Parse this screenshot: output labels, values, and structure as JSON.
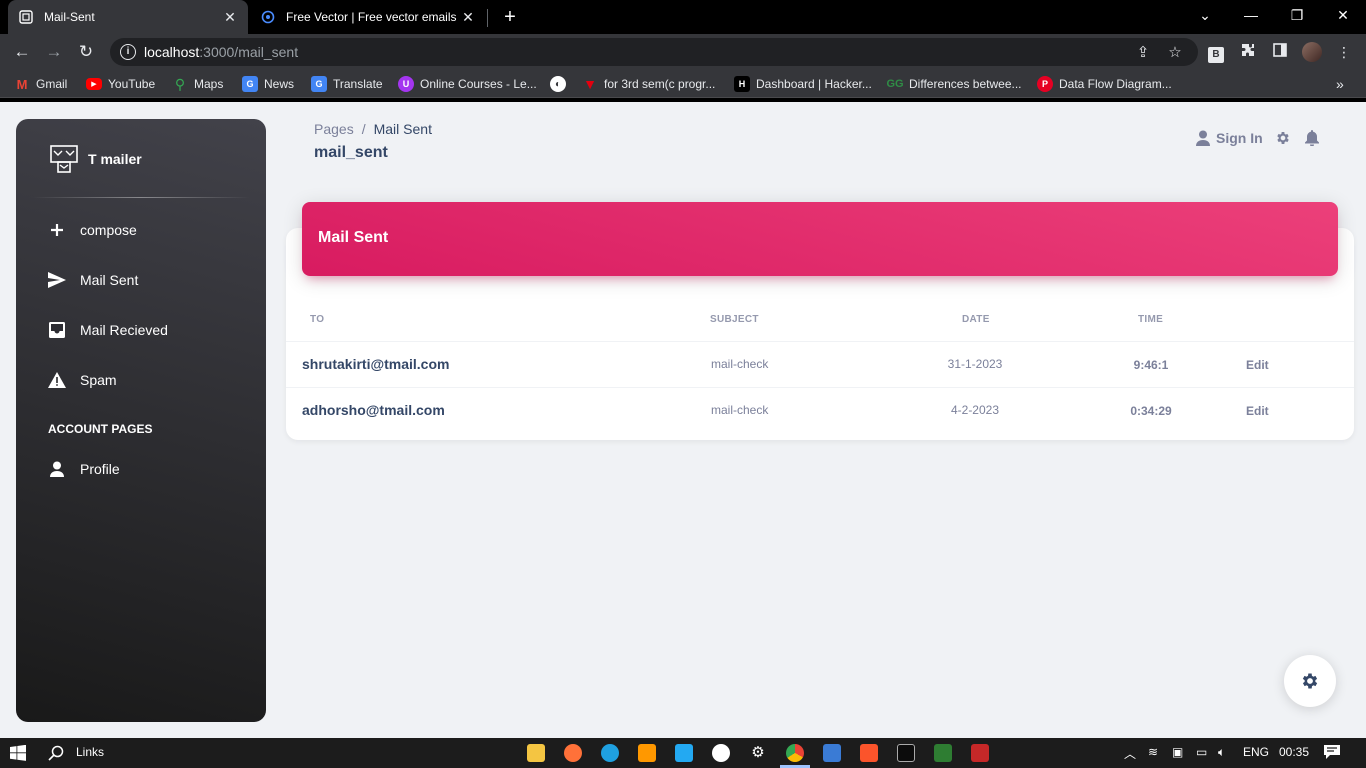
{
  "browser": {
    "tabs": [
      {
        "title": "Mail-Sent",
        "active": true
      },
      {
        "title": "Free Vector | Free vector emails c",
        "active": false
      }
    ],
    "url_host": "localhost",
    "url_path": ":3000/mail_sent",
    "bookmarks": [
      {
        "label": "Gmail",
        "icon": "gmail-icon",
        "color": "#ea4335"
      },
      {
        "label": "YouTube",
        "icon": "youtube-icon",
        "color": "#ff0000"
      },
      {
        "label": "Maps",
        "icon": "maps-icon",
        "color": "#34a853"
      },
      {
        "label": "News",
        "icon": "news-icon",
        "color": "#4285f4"
      },
      {
        "label": "Translate",
        "icon": "translate-icon",
        "color": "#4285f4"
      },
      {
        "label": "Online Courses - Le...",
        "icon": "udemy-icon",
        "color": "#a435f0"
      },
      {
        "label": "",
        "icon": "globe-icon",
        "color": "#ffffff"
      },
      {
        "label": "for 3rd sem(c progr...",
        "icon": "topcoder-icon",
        "color": "#e3000f"
      },
      {
        "label": "Dashboard | Hacker...",
        "icon": "hackerrank-icon",
        "color": "#000000"
      },
      {
        "label": "Differences betwee...",
        "icon": "geeksforgeeks-icon",
        "color": "#2f8d46"
      },
      {
        "label": "Data Flow Diagram...",
        "icon": "pinterest-icon",
        "color": "#e60023"
      }
    ]
  },
  "sidebar": {
    "brand": "T mailer",
    "items": [
      {
        "label": "compose",
        "icon": "plus-icon"
      },
      {
        "label": "Mail Sent",
        "icon": "send-icon"
      },
      {
        "label": "Mail Recieved",
        "icon": "inbox-icon"
      },
      {
        "label": "Spam",
        "icon": "warning-icon"
      }
    ],
    "section_title": "ACCOUNT PAGES",
    "account_items": [
      {
        "label": "Profile",
        "icon": "person-icon"
      }
    ]
  },
  "header": {
    "breadcrumb_root": "Pages",
    "breadcrumb_sep": "/",
    "breadcrumb_current": "Mail Sent",
    "page_title": "mail_sent",
    "signin_label": "Sign In"
  },
  "card": {
    "title": "Mail Sent",
    "columns": [
      "TO",
      "SUBJECT",
      "DATE",
      "TIME"
    ],
    "rows": [
      {
        "to": "shrutakirti@tmail.com",
        "subject": "mail-check",
        "date": "31-1-2023",
        "time": "9:46:1",
        "action": "Edit"
      },
      {
        "to": "adhorsho@tmail.com",
        "subject": "mail-check",
        "date": "4-2-2023",
        "time": "0:34:29",
        "action": "Edit"
      }
    ]
  },
  "taskbar": {
    "search_label": "Links",
    "language": "ENG",
    "clock": "00:35"
  },
  "colors": {
    "accent": "#e91e63",
    "sidebar_dark": "#191919",
    "text_dark": "#344767",
    "text_muted": "#7b809a"
  }
}
